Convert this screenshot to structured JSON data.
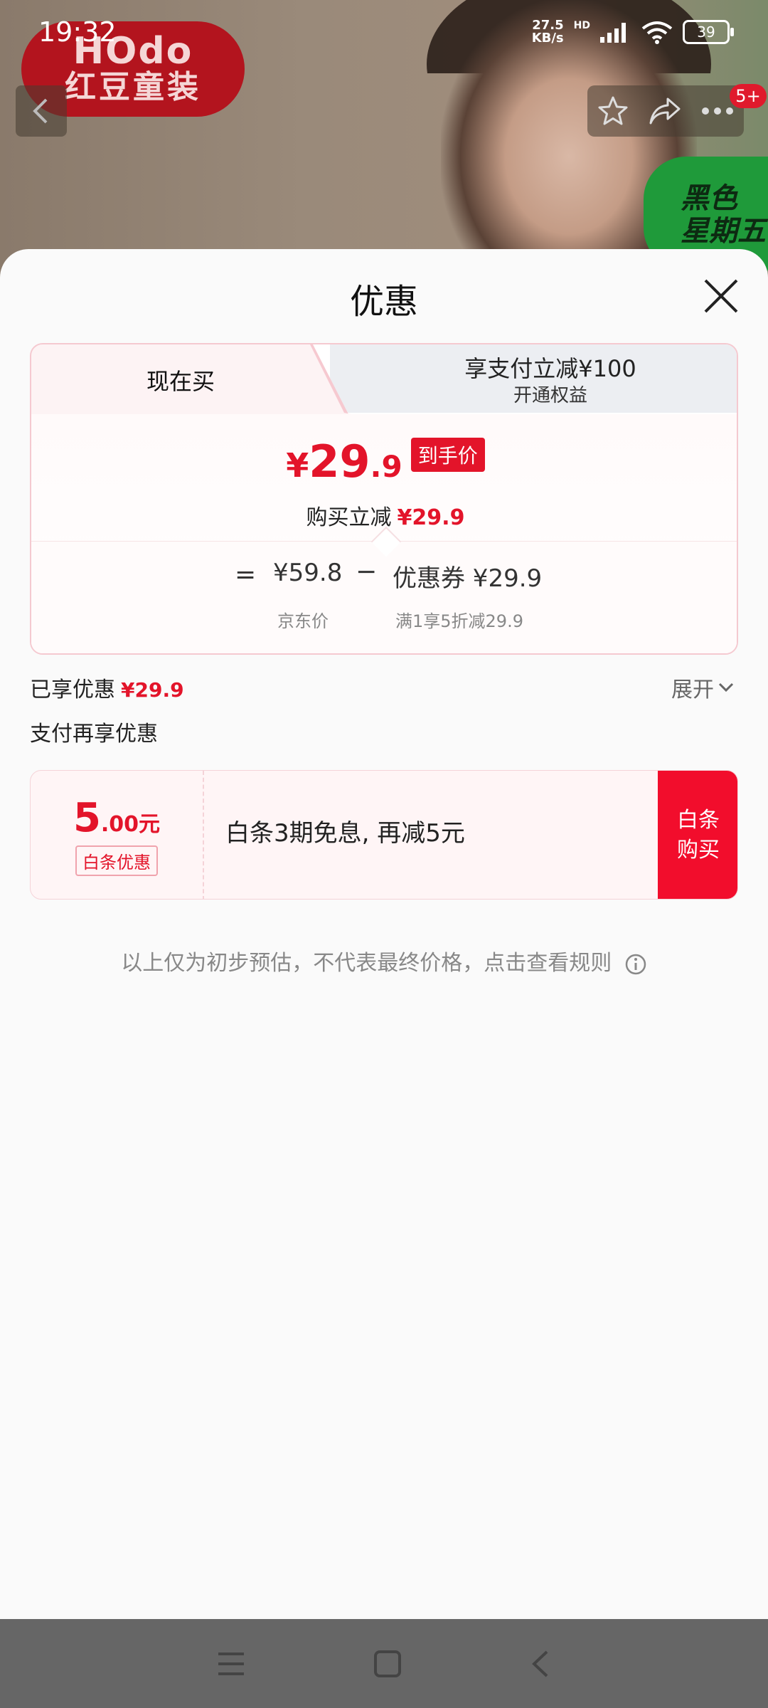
{
  "status_bar": {
    "time": "19:32",
    "net_speed_value": "27.5",
    "net_speed_unit": "KB/s",
    "hd_label": "HD",
    "battery": "39"
  },
  "background": {
    "brand_top": "HOdo",
    "brand_bottom": "红豆童装",
    "promo_badge_line1": "黑色",
    "promo_badge_line2": "星期五",
    "notification_count": "5+"
  },
  "sheet": {
    "title": "优惠",
    "tabs": [
      {
        "label": "现在买"
      },
      {
        "label": "享支付立减¥100",
        "sublabel": "开通权益"
      }
    ],
    "final_price": {
      "currency": "¥",
      "integer": "29",
      "decimal": ".9",
      "tag": "到手价"
    },
    "reduce": {
      "label": "购买立减",
      "amount": "¥29.9"
    },
    "breakdown": {
      "equals": "=",
      "jd_price": "¥59.8",
      "minus": "−",
      "coupon": "优惠券 ¥29.9",
      "jd_label": "京东价",
      "coupon_label": "满1享5折减29.9"
    },
    "enjoyed": {
      "label": "已享优惠",
      "amount": "¥29.9"
    },
    "expand_label": "展开",
    "pay_more_label": "支付再享优惠",
    "promo": {
      "amount_big": "5",
      "amount_small": ".00元",
      "tag": "白条优惠",
      "text": "白条3期免息, 再减5元",
      "button_line1": "白条",
      "button_line2": "购买"
    },
    "disclaimer": "以上仅为初步预估，不代表最终价格，点击查看规则"
  },
  "colors": {
    "accent_red": "#e3142a",
    "brand_red": "#b3141e",
    "promo_green": "#1f9a3a"
  }
}
